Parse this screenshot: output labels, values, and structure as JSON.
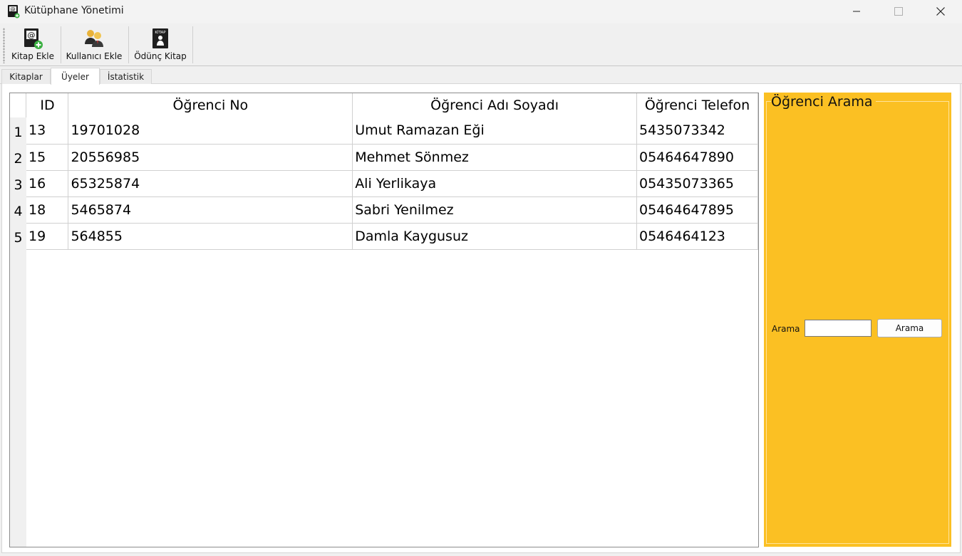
{
  "window": {
    "title": "Kütüphane Yönetimi",
    "icon": "app-book-icon"
  },
  "toolbar": {
    "buttons": [
      {
        "label": "Kitap Ekle",
        "icon": "add-book-icon"
      },
      {
        "label": "Kullanıcı Ekle",
        "icon": "add-user-icon"
      },
      {
        "label": "Ödünç Kitap",
        "icon": "borrow-book-icon"
      }
    ]
  },
  "tabs": [
    {
      "label": "Kitaplar",
      "active": false
    },
    {
      "label": "Üyeler",
      "active": true
    },
    {
      "label": "İstatistik",
      "active": false
    }
  ],
  "grid": {
    "columns": [
      "ID",
      "Öğrenci No",
      "Öğrenci Adı Soyadı",
      "Öğrenci Telefon"
    ],
    "rows": [
      {
        "n": "1",
        "id": "13",
        "no": "19701028",
        "name": "Umut Ramazan Eği",
        "phone": "5435073342"
      },
      {
        "n": "2",
        "id": "15",
        "no": "20556985",
        "name": "Mehmet Sönmez",
        "phone": "05464647890"
      },
      {
        "n": "3",
        "id": "16",
        "no": "65325874",
        "name": "Ali Yerlikaya",
        "phone": "05435073365"
      },
      {
        "n": "4",
        "id": "18",
        "no": "5465874",
        "name": "Sabri Yenilmez",
        "phone": "05464647895"
      },
      {
        "n": "5",
        "id": "19",
        "no": "564855",
        "name": "Damla Kaygusuz",
        "phone": "0546464123"
      }
    ]
  },
  "search": {
    "group_title": "Öğrenci Arama",
    "label": "Arama",
    "input_value": "",
    "button_label": "Arama",
    "panel_color": "#fbc023"
  }
}
